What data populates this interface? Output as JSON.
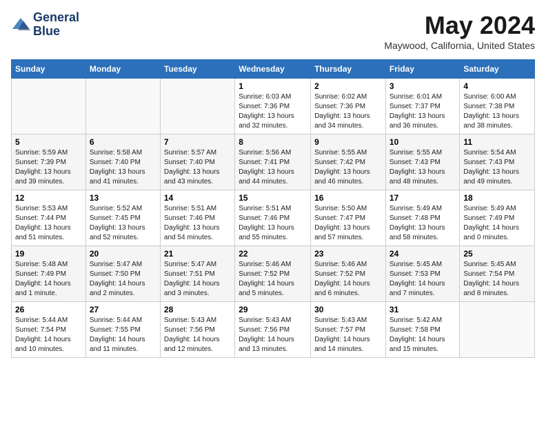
{
  "header": {
    "logo_line1": "General",
    "logo_line2": "Blue",
    "month": "May 2024",
    "location": "Maywood, California, United States"
  },
  "days_of_week": [
    "Sunday",
    "Monday",
    "Tuesday",
    "Wednesday",
    "Thursday",
    "Friday",
    "Saturday"
  ],
  "weeks": [
    [
      {
        "day": "",
        "info": ""
      },
      {
        "day": "",
        "info": ""
      },
      {
        "day": "",
        "info": ""
      },
      {
        "day": "1",
        "info": "Sunrise: 6:03 AM\nSunset: 7:36 PM\nDaylight: 13 hours\nand 32 minutes."
      },
      {
        "day": "2",
        "info": "Sunrise: 6:02 AM\nSunset: 7:36 PM\nDaylight: 13 hours\nand 34 minutes."
      },
      {
        "day": "3",
        "info": "Sunrise: 6:01 AM\nSunset: 7:37 PM\nDaylight: 13 hours\nand 36 minutes."
      },
      {
        "day": "4",
        "info": "Sunrise: 6:00 AM\nSunset: 7:38 PM\nDaylight: 13 hours\nand 38 minutes."
      }
    ],
    [
      {
        "day": "5",
        "info": "Sunrise: 5:59 AM\nSunset: 7:39 PM\nDaylight: 13 hours\nand 39 minutes."
      },
      {
        "day": "6",
        "info": "Sunrise: 5:58 AM\nSunset: 7:40 PM\nDaylight: 13 hours\nand 41 minutes."
      },
      {
        "day": "7",
        "info": "Sunrise: 5:57 AM\nSunset: 7:40 PM\nDaylight: 13 hours\nand 43 minutes."
      },
      {
        "day": "8",
        "info": "Sunrise: 5:56 AM\nSunset: 7:41 PM\nDaylight: 13 hours\nand 44 minutes."
      },
      {
        "day": "9",
        "info": "Sunrise: 5:55 AM\nSunset: 7:42 PM\nDaylight: 13 hours\nand 46 minutes."
      },
      {
        "day": "10",
        "info": "Sunrise: 5:55 AM\nSunset: 7:43 PM\nDaylight: 13 hours\nand 48 minutes."
      },
      {
        "day": "11",
        "info": "Sunrise: 5:54 AM\nSunset: 7:43 PM\nDaylight: 13 hours\nand 49 minutes."
      }
    ],
    [
      {
        "day": "12",
        "info": "Sunrise: 5:53 AM\nSunset: 7:44 PM\nDaylight: 13 hours\nand 51 minutes."
      },
      {
        "day": "13",
        "info": "Sunrise: 5:52 AM\nSunset: 7:45 PM\nDaylight: 13 hours\nand 52 minutes."
      },
      {
        "day": "14",
        "info": "Sunrise: 5:51 AM\nSunset: 7:46 PM\nDaylight: 13 hours\nand 54 minutes."
      },
      {
        "day": "15",
        "info": "Sunrise: 5:51 AM\nSunset: 7:46 PM\nDaylight: 13 hours\nand 55 minutes."
      },
      {
        "day": "16",
        "info": "Sunrise: 5:50 AM\nSunset: 7:47 PM\nDaylight: 13 hours\nand 57 minutes."
      },
      {
        "day": "17",
        "info": "Sunrise: 5:49 AM\nSunset: 7:48 PM\nDaylight: 13 hours\nand 58 minutes."
      },
      {
        "day": "18",
        "info": "Sunrise: 5:49 AM\nSunset: 7:49 PM\nDaylight: 14 hours\nand 0 minutes."
      }
    ],
    [
      {
        "day": "19",
        "info": "Sunrise: 5:48 AM\nSunset: 7:49 PM\nDaylight: 14 hours\nand 1 minute."
      },
      {
        "day": "20",
        "info": "Sunrise: 5:47 AM\nSunset: 7:50 PM\nDaylight: 14 hours\nand 2 minutes."
      },
      {
        "day": "21",
        "info": "Sunrise: 5:47 AM\nSunset: 7:51 PM\nDaylight: 14 hours\nand 3 minutes."
      },
      {
        "day": "22",
        "info": "Sunrise: 5:46 AM\nSunset: 7:52 PM\nDaylight: 14 hours\nand 5 minutes."
      },
      {
        "day": "23",
        "info": "Sunrise: 5:46 AM\nSunset: 7:52 PM\nDaylight: 14 hours\nand 6 minutes."
      },
      {
        "day": "24",
        "info": "Sunrise: 5:45 AM\nSunset: 7:53 PM\nDaylight: 14 hours\nand 7 minutes."
      },
      {
        "day": "25",
        "info": "Sunrise: 5:45 AM\nSunset: 7:54 PM\nDaylight: 14 hours\nand 8 minutes."
      }
    ],
    [
      {
        "day": "26",
        "info": "Sunrise: 5:44 AM\nSunset: 7:54 PM\nDaylight: 14 hours\nand 10 minutes."
      },
      {
        "day": "27",
        "info": "Sunrise: 5:44 AM\nSunset: 7:55 PM\nDaylight: 14 hours\nand 11 minutes."
      },
      {
        "day": "28",
        "info": "Sunrise: 5:43 AM\nSunset: 7:56 PM\nDaylight: 14 hours\nand 12 minutes."
      },
      {
        "day": "29",
        "info": "Sunrise: 5:43 AM\nSunset: 7:56 PM\nDaylight: 14 hours\nand 13 minutes."
      },
      {
        "day": "30",
        "info": "Sunrise: 5:43 AM\nSunset: 7:57 PM\nDaylight: 14 hours\nand 14 minutes."
      },
      {
        "day": "31",
        "info": "Sunrise: 5:42 AM\nSunset: 7:58 PM\nDaylight: 14 hours\nand 15 minutes."
      },
      {
        "day": "",
        "info": ""
      }
    ]
  ]
}
